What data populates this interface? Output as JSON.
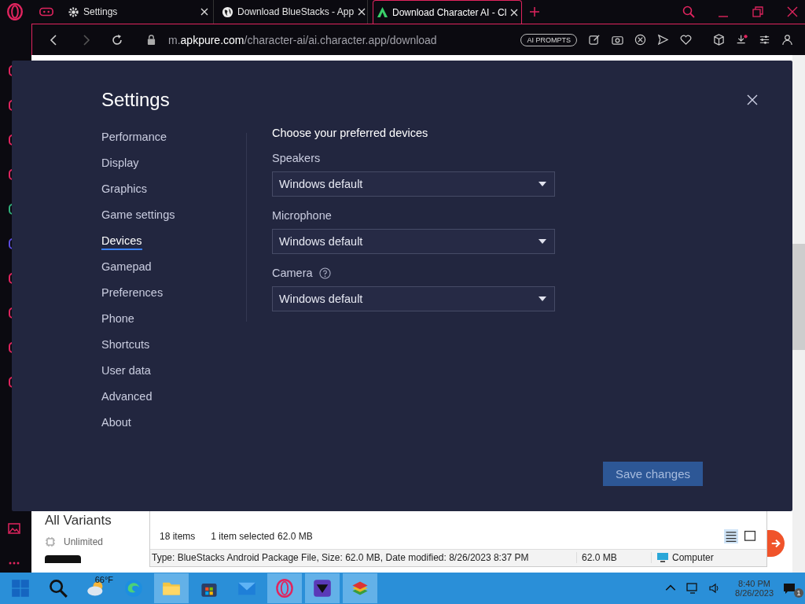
{
  "browser": {
    "tabs": [
      {
        "label": "Settings",
        "selected": false
      },
      {
        "label": "Download BlueStacks - App",
        "selected": false
      },
      {
        "label": "Download Character AI - Cl",
        "selected": true
      }
    ],
    "address": "m.**apkpure.com**/character-ai/ai.character.app/download",
    "badge": "AI PROMPTS"
  },
  "page": {
    "heading": "All Variants",
    "option": "Unlimited"
  },
  "explorer": {
    "item_count": "18 items",
    "selection": "1 item selected",
    "selection_size": "62.0 MB",
    "details": "Type: BlueStacks Android Package File, Size: 62.0 MB, Date modified: 8/26/2023 8:37 PM",
    "size": "62.0 MB",
    "location": "Computer"
  },
  "settings": {
    "title": "Settings",
    "nav": [
      {
        "label": "Performance",
        "selected": false
      },
      {
        "label": "Display",
        "selected": false
      },
      {
        "label": "Graphics",
        "selected": false
      },
      {
        "label": "Game settings",
        "selected": false
      },
      {
        "label": "Devices",
        "selected": true
      },
      {
        "label": "Gamepad",
        "selected": false
      },
      {
        "label": "Preferences",
        "selected": false
      },
      {
        "label": "Phone",
        "selected": false
      },
      {
        "label": "Shortcuts",
        "selected": false
      },
      {
        "label": "User data",
        "selected": false
      },
      {
        "label": "Advanced",
        "selected": false
      },
      {
        "label": "About",
        "selected": false
      }
    ],
    "section_title": "Choose your preferred devices",
    "devices": [
      {
        "label": "Speakers",
        "value": "Windows default",
        "help": false
      },
      {
        "label": "Microphone",
        "value": "Windows default",
        "help": false
      },
      {
        "label": "Camera",
        "value": "Windows default",
        "help": true
      }
    ],
    "save_button": {
      "label": "Save changes",
      "disabled": true
    }
  },
  "taskbar": {
    "weather": "66°F",
    "time": "8:40 PM",
    "date": "8/26/2023",
    "notifications": "1",
    "apps": [
      {
        "kind": "start",
        "active": false
      },
      {
        "kind": "search",
        "active": false
      },
      {
        "kind": "weather",
        "active": false
      },
      {
        "kind": "edge",
        "active": false
      },
      {
        "kind": "folder",
        "active": true
      },
      {
        "kind": "store",
        "active": false
      },
      {
        "kind": "mail",
        "active": false
      },
      {
        "kind": "opera",
        "active": true
      },
      {
        "kind": "shield",
        "active": true
      },
      {
        "kind": "stack",
        "active": true
      }
    ]
  }
}
